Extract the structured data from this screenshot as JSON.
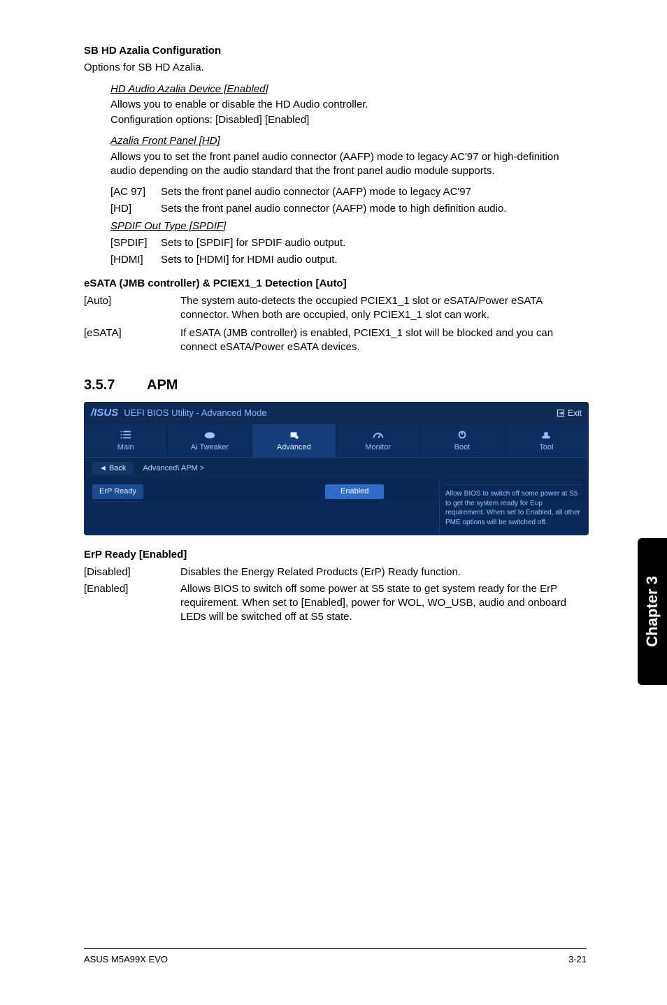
{
  "sb_hd": {
    "title": "SB HD Azalia Configuration",
    "options_for": "Options for SB HD Azalia.",
    "hd_audio_head": "HD Audio Azalia Device [Enabled]",
    "hd_audio_desc": "Allows you to enable or disable the HD Audio controller.",
    "hd_audio_cfg": "Configuration options: [Disabled] [Enabled]",
    "front_panel_head": "Azalia Front Panel [HD]",
    "front_panel_desc": "Allows you to set the front panel audio connector (AAFP) mode to legacy AC'97 or high-definition audio depending on the audio standard that the front panel audio module supports.",
    "ac97_label": "[AC 97]",
    "ac97_val": "Sets the front panel audio connector (AAFP) mode to legacy AC'97",
    "hd_label": "[HD]",
    "hd_val": "Sets the front panel audio connector (AAFP) mode to high definition audio.",
    "spdif_head": "SPDIF Out Type [SPDIF]",
    "spdif_label": "[SPDIF]",
    "spdif_val": "Sets to [SPDIF] for SPDIF audio output.",
    "hdmi_label": "[HDMI]",
    "hdmi_val": "Sets to [HDMI] for HDMI audio output."
  },
  "esata": {
    "title": "eSATA (JMB controller) & PCIEX1_1 Detection [Auto]",
    "auto_label": "[Auto]",
    "auto_val": "The system auto-detects the occupied PCIEX1_1 slot or eSATA/Power eSATA connector. When both are occupied, only PCIEX1_1 slot can work.",
    "esata_label": "[eSATA]",
    "esata_val": "If eSATA (JMB controller) is enabled, PCIEX1_1 slot will be blocked and you can connect eSATA/Power eSATA devices."
  },
  "apm": {
    "section_num": "3.5.7",
    "section_title": "APM"
  },
  "bios": {
    "brand": "/ISUS",
    "title": "UEFI BIOS Utility - Advanced Mode",
    "exit": "Exit",
    "tabs": {
      "main": "Main",
      "tweaker": "Ai  Tweaker",
      "advanced": "Advanced",
      "monitor": "Monitor",
      "boot": "Boot",
      "tool": "Tool"
    },
    "back": "Back",
    "crumb": "Advanced\\ APM  >",
    "setting_label": "ErP Ready",
    "setting_val": "Enabled",
    "help": "Allow BIOS to switch off some power at S5 to get the system ready for Eup requirement. When set to Enabled, all other PME options will be switched off."
  },
  "erp": {
    "title": "ErP Ready [Enabled]",
    "dis_label": "[Disabled]",
    "dis_val": "Disables the Energy Related Products (ErP) Ready function.",
    "en_label": "[Enabled]",
    "en_val": "Allows BIOS to switch off some power at S5 state to get system ready for the ErP requirement. When set to [Enabled], power for WOL, WO_USB, audio and onboard LEDs will be switched off at S5 state."
  },
  "side_tab": "Chapter 3",
  "footer_left": "ASUS M5A99X EVO",
  "footer_right": "3-21"
}
